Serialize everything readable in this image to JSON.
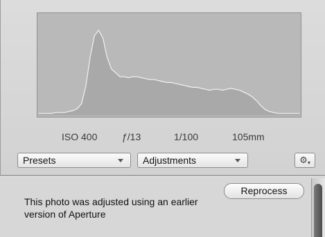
{
  "histogram": {
    "levels": [
      0.02,
      0.02,
      0.02,
      0.02,
      0.03,
      0.03,
      0.03,
      0.04,
      0.05,
      0.07,
      0.12,
      0.3,
      0.6,
      0.82,
      0.88,
      0.8,
      0.6,
      0.48,
      0.44,
      0.4,
      0.4,
      0.39,
      0.4,
      0.4,
      0.39,
      0.38,
      0.37,
      0.37,
      0.36,
      0.35,
      0.34,
      0.34,
      0.33,
      0.32,
      0.31,
      0.3,
      0.29,
      0.29,
      0.28,
      0.27,
      0.26,
      0.27,
      0.27,
      0.26,
      0.27,
      0.28,
      0.27,
      0.26,
      0.24,
      0.22,
      0.19,
      0.15,
      0.1,
      0.06,
      0.04,
      0.03,
      0.02,
      0.02,
      0.02,
      0.02,
      0.02,
      0.02
    ]
  },
  "exif": {
    "iso": "ISO 400",
    "aperture": "ƒ/13",
    "shutter": "1/100",
    "focal_length": "105mm"
  },
  "toolbar": {
    "presets_label": "Presets",
    "adjustments_label": "Adjustments",
    "gear_icon": "gear-icon"
  },
  "notice": {
    "text": "This photo was adjusted using an earlier version of Aperture",
    "reprocess_label": "Reprocess"
  }
}
